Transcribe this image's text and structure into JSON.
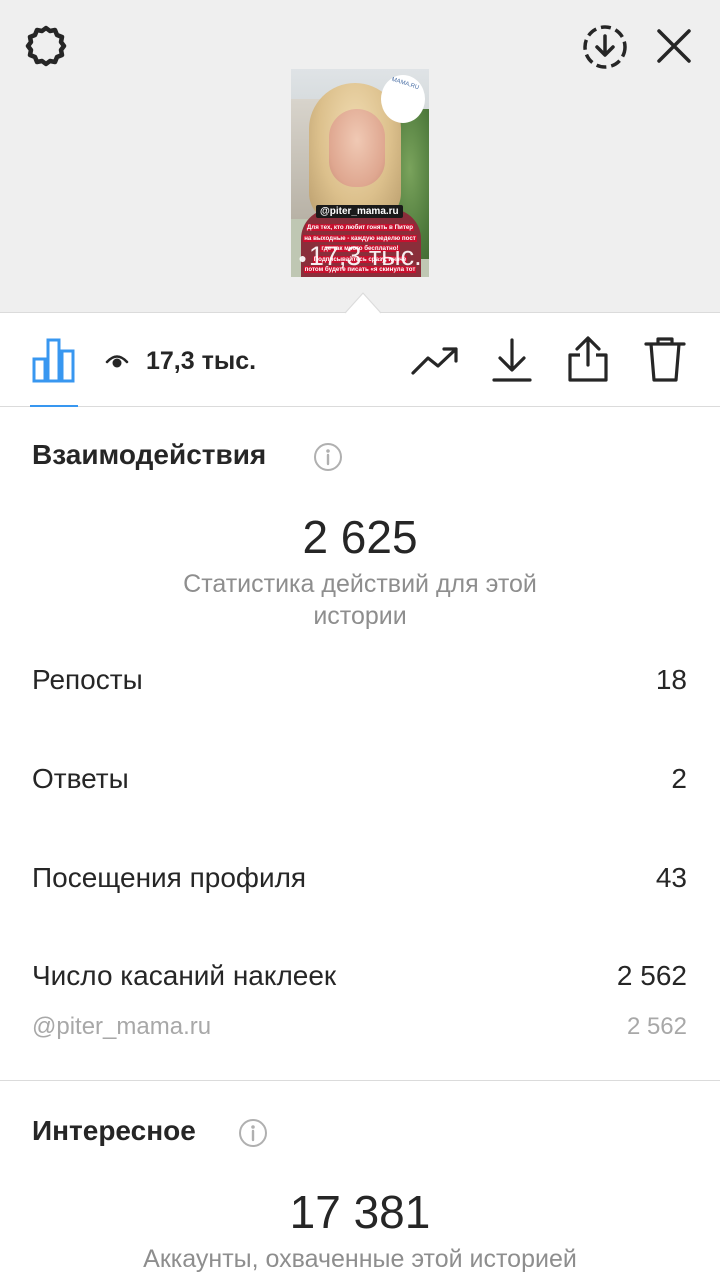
{
  "story_preview": {
    "handle_sticker": "@piter_mama.ru",
    "overlay_text_lines": [
      "Для тех, кто любит гонять в Питер",
      "на выходные - каждую неделю пост",
      "где так много бесплатно!",
      "Подписывайтесь сразу, иначе",
      "потом будете писать «я скинула тот"
    ],
    "views_overlay": "17,3 тыс.",
    "cloud_text": "MAMA.RU"
  },
  "toolbar": {
    "views_count": "17,3 тыс."
  },
  "interactions": {
    "title": "Взаимодействия",
    "total": "2 625",
    "caption": "Статистика действий для этой истории",
    "rows": [
      {
        "label": "Репосты",
        "value": "18"
      },
      {
        "label": "Ответы",
        "value": "2"
      },
      {
        "label": "Посещения профиля",
        "value": "43"
      },
      {
        "label": "Число касаний наклеек",
        "value": "2 562"
      }
    ],
    "sub_row": {
      "label": "@piter_mama.ru",
      "value": "2 562"
    }
  },
  "discovery": {
    "title": "Интересное",
    "total": "17 381",
    "caption": "Аккаунты, охваченные этой историей"
  },
  "colors": {
    "accent": "#3897f0",
    "text": "#262626",
    "muted": "#8e8e8e",
    "top_background": "#efefef"
  },
  "icons": [
    "gear-icon",
    "save-circle-icon",
    "close-icon",
    "bar-chart-icon",
    "eye-icon",
    "trending-icon",
    "download-icon",
    "share-icon",
    "trash-icon",
    "info-icon"
  ]
}
